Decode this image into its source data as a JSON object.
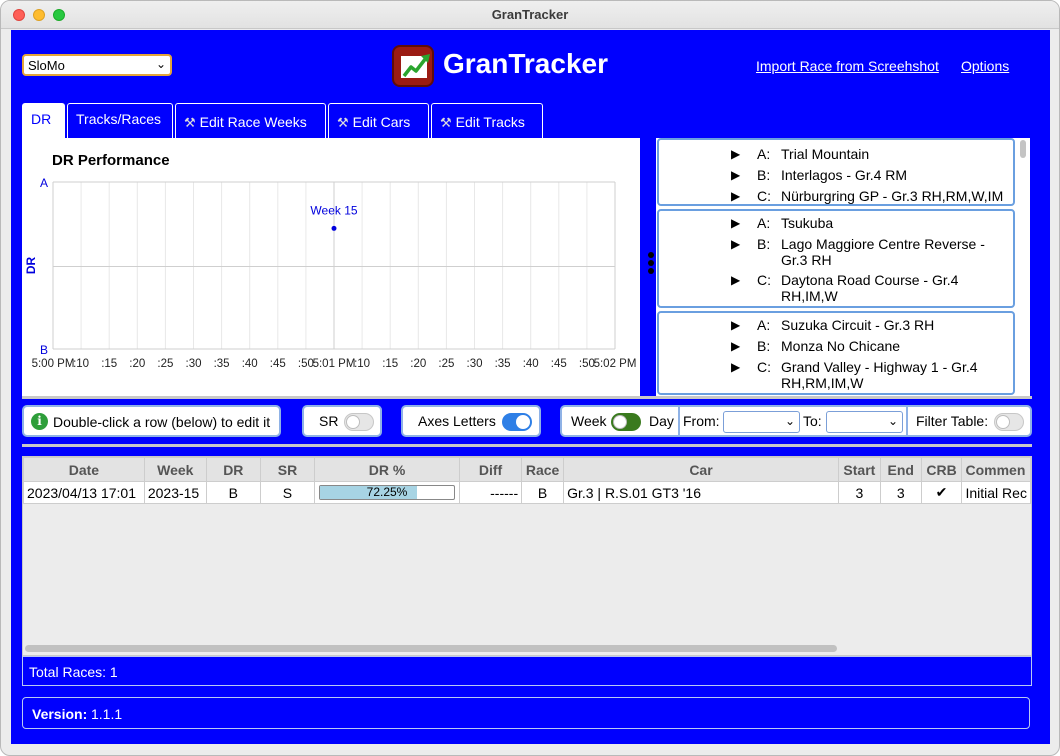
{
  "window": {
    "title": "GranTracker"
  },
  "header": {
    "profile": "SloMo",
    "app_name": "GranTracker",
    "import_link": "Import Race from Screehshot",
    "options_link": "Options"
  },
  "tabs": [
    {
      "label": "DR",
      "active": true,
      "icon": ""
    },
    {
      "label": "Tracks/Races",
      "active": false,
      "icon": ""
    },
    {
      "label": "Edit Race Weeks",
      "active": false,
      "icon": "tools-icon"
    },
    {
      "label": "Edit Cars",
      "active": false,
      "icon": "tools-icon"
    },
    {
      "label": "Edit Tracks",
      "active": false,
      "icon": "tools-icon"
    }
  ],
  "chart_data": {
    "type": "scatter",
    "title": "DR Performance",
    "xlabel": "",
    "ylabel": "DR",
    "y_ticks": [
      "A",
      "B"
    ],
    "x_ticks": [
      "5:00 PM",
      ":10",
      ":15",
      ":20",
      ":25",
      ":30",
      ":35",
      ":40",
      ":45",
      ":50",
      "5:01 PM",
      ":10",
      ":15",
      ":20",
      ":25",
      ":30",
      ":35",
      ":40",
      ":45",
      ":50",
      "5:02 PM"
    ],
    "xlim": [
      "5:00 PM",
      "5:02 PM"
    ],
    "grid": true,
    "points": [
      {
        "x": "5:01 PM",
        "y": 0.7225,
        "label": "Week 15",
        "color": "#0000dd"
      }
    ],
    "colors": {
      "point": "#0000dd",
      "label": "#0000dd",
      "ylabel": "#0000dd",
      "axis": "#0000dd"
    }
  },
  "race_weeks": [
    {
      "races": [
        {
          "letter": "A:",
          "name": "Trial Mountain"
        },
        {
          "letter": "B:",
          "name": "Interlagos - Gr.4 RM"
        },
        {
          "letter": "C:",
          "name": "Nürburgring GP - Gr.3 RH,RM,W,IM"
        }
      ]
    },
    {
      "races": [
        {
          "letter": "A:",
          "name": "Tsukuba"
        },
        {
          "letter": "B:",
          "name": "Lago Maggiore Centre Reverse - Gr.3 RH"
        },
        {
          "letter": "C:",
          "name": "Daytona Road Course - Gr.4 RH,IM,W"
        }
      ]
    },
    {
      "races": [
        {
          "letter": "A:",
          "name": "Suzuka Circuit - Gr.3 RH"
        },
        {
          "letter": "B:",
          "name": "Monza No Chicane"
        },
        {
          "letter": "C:",
          "name": "Grand Valley - Highway 1 - Gr.4 RH,RM,IM,W"
        }
      ]
    }
  ],
  "controls": {
    "hint": "Double-click a row (below) to edit it",
    "sr_label": "SR",
    "sr_on": false,
    "axes_label": "Axes Letters",
    "axes_on": true,
    "week_label": "Week",
    "day_label": "Day",
    "from_label": "From:",
    "to_label": "To:",
    "filter_label": "Filter Table:",
    "filter_on": false
  },
  "table": {
    "columns": [
      "Date",
      "Week",
      "DR",
      "SR",
      "DR %",
      "Diff",
      "Race",
      "Car",
      "Start",
      "End",
      "CRB",
      "Commen"
    ],
    "rows": [
      {
        "date": "2023/04/13 17:01",
        "week": "2023-15",
        "dr": "B",
        "sr": "S",
        "dr_pct_label": "72.25%",
        "dr_pct": 72.25,
        "diff": "------",
        "race": "B",
        "car": "Gr.3 | R.S.01 GT3 '16",
        "start": "3",
        "end": "3",
        "crb": "✔",
        "comment": "Initial Rec"
      }
    ]
  },
  "footer": {
    "total_races": "Total Races: 1",
    "version_label": "Version:",
    "version": "1.1.1"
  }
}
